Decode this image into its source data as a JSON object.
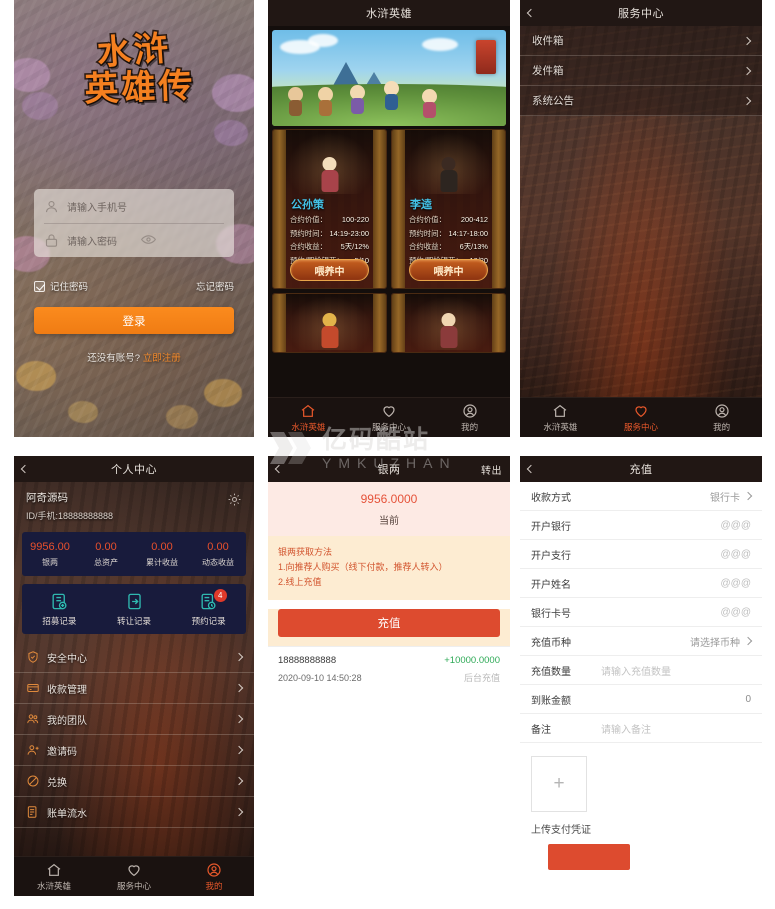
{
  "watermark": {
    "cn": "亿码酷站",
    "en": "YMKUZHAN"
  },
  "login": {
    "logo_line1": "水浒",
    "logo_line2": "英雄传",
    "phone_placeholder": "请输入手机号",
    "password_placeholder": "请输入密码",
    "remember_label": "记住密码",
    "forgot_label": "忘记密码",
    "login_button": "登录",
    "signup_prefix": "还没有账号?",
    "signup_link": "立即注册"
  },
  "game": {
    "title": "水浒英雄",
    "cards": [
      {
        "name": "公孙策",
        "rows": [
          {
            "label": "合约价值：",
            "value": "100-220"
          },
          {
            "label": "预约时间：",
            "value": "14:19-23:00"
          },
          {
            "label": "合约收益：",
            "value": "5天/12%"
          },
          {
            "label": "预约/即抢银两：",
            "value": "5/10"
          }
        ],
        "button": "喂养中"
      },
      {
        "name": "李逵",
        "rows": [
          {
            "label": "合约价值：",
            "value": "200-412"
          },
          {
            "label": "预约时间：",
            "value": "14:17-18:00"
          },
          {
            "label": "合约收益：",
            "value": "6天/13%"
          },
          {
            "label": "预约/即抢银两：",
            "value": "10/20"
          }
        ],
        "button": "喂养中"
      }
    ]
  },
  "service": {
    "title": "服务中心",
    "items": [
      {
        "label": "收件箱"
      },
      {
        "label": "发件箱"
      },
      {
        "label": "系统公告"
      }
    ]
  },
  "profile": {
    "title": "个人中心",
    "username": "阿奇源码",
    "user_id": "ID/手机:18888888888",
    "stats": [
      {
        "value": "9956.00",
        "label": "银两"
      },
      {
        "value": "0.00",
        "label": "总资产"
      },
      {
        "value": "0.00",
        "label": "累计收益"
      },
      {
        "value": "0.00",
        "label": "动态收益"
      }
    ],
    "quick": [
      {
        "label": "招募记录",
        "badge": ""
      },
      {
        "label": "转让记录",
        "badge": ""
      },
      {
        "label": "预约记录",
        "badge": "4"
      }
    ],
    "menu": [
      {
        "label": "安全中心"
      },
      {
        "label": "收款管理"
      },
      {
        "label": "我的团队"
      },
      {
        "label": "邀请码"
      },
      {
        "label": "兑换"
      },
      {
        "label": "账单流水"
      }
    ]
  },
  "wallet": {
    "title": "银两",
    "transfer_out": "转出",
    "amount": "9956.0000",
    "amount_label": "当前",
    "info_title": "银两获取方法",
    "info_line1": "1.向推荐人购买（线下付款，推荐人转入）",
    "info_line2": "2.线上充值",
    "recharge_button": "充值",
    "transactions": [
      {
        "account": "18888888888",
        "amount": "+10000.0000",
        "date": "2020-09-10 14:50:28",
        "note": "后台充值"
      }
    ]
  },
  "recharge": {
    "title": "充值",
    "rows": [
      {
        "label": "收款方式",
        "value": "银行卡",
        "chevron": true
      },
      {
        "label": "开户银行",
        "value": "@@@",
        "chevron": false
      },
      {
        "label": "开户支行",
        "value": "@@@",
        "chevron": false
      },
      {
        "label": "开户姓名",
        "value": "@@@",
        "chevron": false
      },
      {
        "label": "银行卡号",
        "value": "@@@",
        "chevron": false
      },
      {
        "label": "充值币种",
        "value": "请选择币种",
        "chevron": true
      }
    ],
    "amount_label": "充值数量",
    "amount_placeholder": "请输入充值数量",
    "received_label": "到账金额",
    "received_value": "0",
    "note_label": "备注",
    "note_placeholder": "请输入备注",
    "upload_plus": "+",
    "upload_label": "上传支付凭证",
    "submit_label": ""
  },
  "tabbar": {
    "items": [
      {
        "label": "水浒英雄",
        "icon": "home-icon"
      },
      {
        "label": "服务中心",
        "icon": "heart-icon"
      },
      {
        "label": "我的",
        "icon": "person-icon"
      }
    ]
  },
  "colors": {
    "accent_orange": "#f58020",
    "accent_red": "#dd4b2f",
    "stat_navy": "#181b3c",
    "stat_red": "#e8502c",
    "cyan_name": "#44c3e8",
    "green_amount": "#2faa57"
  }
}
